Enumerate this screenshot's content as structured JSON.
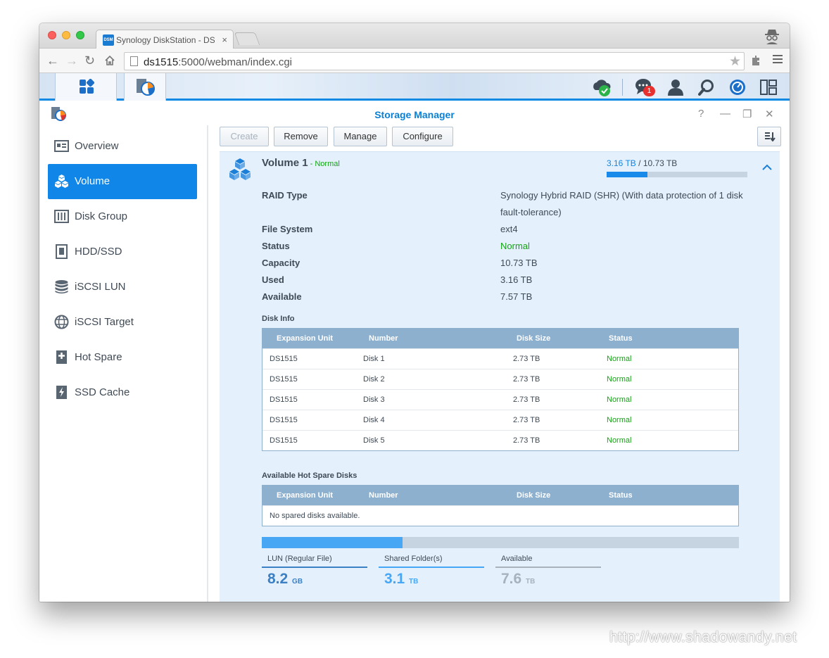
{
  "browser": {
    "tab_title": "Synology DiskStation - DS",
    "tab_favicon_text": "DSM",
    "url_host": "ds1515",
    "url_rest": ":5000/webman/index.cgi"
  },
  "dsm": {
    "notification_count": "1"
  },
  "app": {
    "title": "Storage Manager",
    "help_glyph": "?",
    "minimize_glyph": "—",
    "restore_glyph": "❐",
    "close_glyph": "✕"
  },
  "sidebar": {
    "items": [
      {
        "label": "Overview",
        "icon": "overview-icon"
      },
      {
        "label": "Volume",
        "icon": "volume-icon"
      },
      {
        "label": "Disk Group",
        "icon": "disk-group-icon"
      },
      {
        "label": "HDD/SSD",
        "icon": "hdd-icon"
      },
      {
        "label": "iSCSI LUN",
        "icon": "iscsi-lun-icon"
      },
      {
        "label": "iSCSI Target",
        "icon": "globe-icon"
      },
      {
        "label": "Hot Spare",
        "icon": "hot-spare-icon"
      },
      {
        "label": "SSD Cache",
        "icon": "ssd-cache-icon"
      }
    ],
    "active_index": 1
  },
  "toolbar": {
    "create": "Create",
    "remove": "Remove",
    "manage": "Manage",
    "configure": "Configure"
  },
  "volume": {
    "name": "Volume 1",
    "status_suffix": " - Normal",
    "used": "3.16 TB",
    "total_suffix": " / 10.73 TB",
    "used_fraction": 0.29,
    "properties": [
      {
        "label": "RAID Type",
        "value": "Synology Hybrid RAID (SHR) (With data protection of 1 disk fault-tolerance)"
      },
      {
        "label": "File System",
        "value": "ext4"
      },
      {
        "label": "Status",
        "value": "Normal"
      },
      {
        "label": "Capacity",
        "value": "10.73 TB"
      },
      {
        "label": "Used",
        "value": "3.16 TB"
      },
      {
        "label": "Available",
        "value": "7.57 TB"
      }
    ]
  },
  "disk_info": {
    "title": "Disk Info",
    "columns": [
      "Expansion Unit",
      "Number",
      "Disk Size",
      "Status"
    ],
    "rows": [
      [
        "DS1515",
        "Disk 1",
        "2.73 TB",
        "Normal"
      ],
      [
        "DS1515",
        "Disk 2",
        "2.73 TB",
        "Normal"
      ],
      [
        "DS1515",
        "Disk 3",
        "2.73 TB",
        "Normal"
      ],
      [
        "DS1515",
        "Disk 4",
        "2.73 TB",
        "Normal"
      ],
      [
        "DS1515",
        "Disk 5",
        "2.73 TB",
        "Normal"
      ]
    ]
  },
  "hot_spare": {
    "title": "Available Hot Spare Disks",
    "columns": [
      "Expansion Unit",
      "Number",
      "Disk Size",
      "Status"
    ],
    "empty_text": "No spared disks available."
  },
  "allocation": {
    "fraction_shared": 0.295,
    "items": [
      {
        "label": "LUN (Regular File)",
        "value": "8.2",
        "unit": "GB",
        "color": "#3b7fc4"
      },
      {
        "label": "Shared Folder(s)",
        "value": "3.1",
        "unit": "TB",
        "color": "#48a7f5"
      },
      {
        "label": "Available",
        "value": "7.6",
        "unit": "TB",
        "color": "#a7b2bd"
      }
    ]
  },
  "watermark": "http://www.shadowandy.net"
}
